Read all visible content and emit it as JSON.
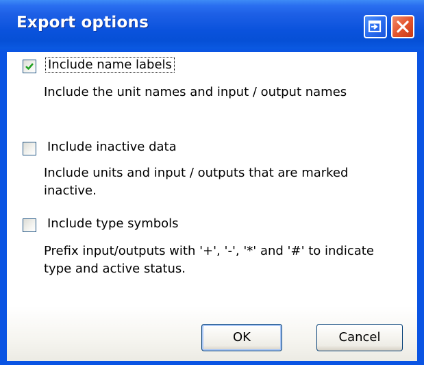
{
  "window": {
    "title": "Export options"
  },
  "options": [
    {
      "label": "Include name labels",
      "description": "Include the unit names and input / output names",
      "checked": true
    },
    {
      "label": "Include inactive data",
      "description": "Include units and input / outputs that are marked inactive.",
      "checked": false
    },
    {
      "label": "Include type symbols",
      "description": "Prefix input/outputs with '+', '-', '*' and '#' to indicate type and active status.",
      "checked": false
    }
  ],
  "buttons": {
    "ok_label": "OK",
    "cancel_label": "Cancel"
  },
  "colors": {
    "titlebar": "#0a54e3",
    "close_button": "#e4552e",
    "checkmark": "#21a121"
  },
  "icons": {
    "restore": "restore-icon",
    "close": "close-icon",
    "check": "checkmark-icon"
  }
}
